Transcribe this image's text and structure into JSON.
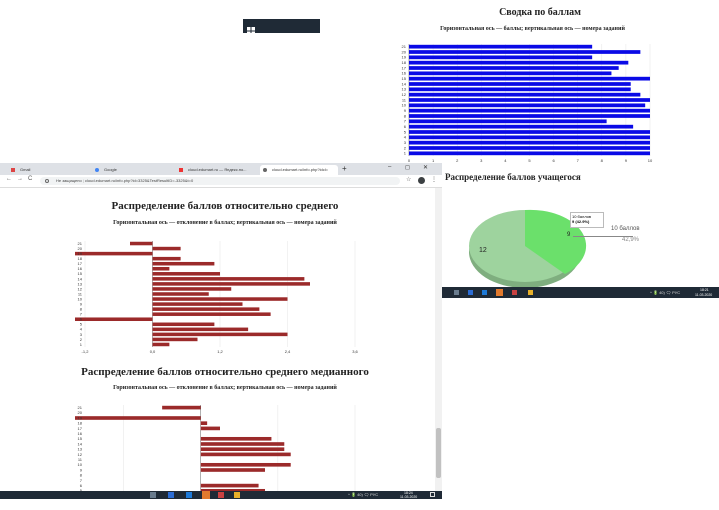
{
  "colors": {
    "blue_bars": "#0a0ae6",
    "red_bars": "#9b2a2a",
    "taskbar": "#1f2a36",
    "pie_light": "#6be06b",
    "pie_dark": "#9ed39e"
  },
  "top_left_tile": {
    "icon": "windows-logo-icon"
  },
  "summary": {
    "title": "Сводка по баллам",
    "subtitle": "Горизонтальная ось — баллы; вертикальная ось — номера заданий"
  },
  "student_dist": {
    "title": "Распределение баллов учащегося",
    "tooltip_line1": "10 баллов",
    "tooltip_line2": "9 (42.9%)",
    "label_9": "9",
    "label_12": "12",
    "legend_label": "10 баллов",
    "legend_pct": "42,9%"
  },
  "browser": {
    "tabs": [
      {
        "label": "Gmail",
        "icon": "mail-icon"
      },
      {
        "label": "Google",
        "icon": "google-icon"
      },
      {
        "label": "cloud.edumart.ru — Яндекс.по...",
        "icon": "yandex-icon"
      },
      {
        "label": "cloud.edumart.ru/info.php?idcl=",
        "icon": "globe-icon"
      }
    ],
    "new_tab": "+",
    "address_prefix": "Не защищено",
    "address": "cloud.edumart.ru/info.php?id=3325&TestResultID=-3325&t=0",
    "win_min": "–",
    "win_max": "◻",
    "win_close": "✕"
  },
  "section1": {
    "title": "Распределение баллов относительно среднего",
    "subtitle": "Горизонтальная ось — отклонение в баллах; вертикальная ось — номера заданий"
  },
  "section2": {
    "title": "Распределение баллов относительно среднего медианного",
    "subtitle": "Горизонтальная ось — отклонение в баллах; вертикальная ось — номера заданий"
  },
  "taskbar_right": {
    "tray": "^ 🔋 40) 🗨 РУС",
    "time": "18:21",
    "date": "11.03.2020"
  },
  "taskbar_bottom": {
    "tray": "^ 🔋 40) 🗨 РУС",
    "time": "18:24",
    "date": "11.03.2020"
  },
  "chart_data": [
    {
      "type": "bar",
      "orientation": "horizontal",
      "title": "Сводка по баллам",
      "subtitle": "Горизонтальная ось — баллы; вертикальная ось — номера заданий",
      "categories": [
        "1",
        "2",
        "3",
        "4",
        "5",
        "6",
        "7",
        "8",
        "9",
        "10",
        "11",
        "12",
        "13",
        "14",
        "15",
        "16",
        "17",
        "18",
        "19",
        "20",
        "21"
      ],
      "values": [
        10,
        10,
        10,
        10,
        10,
        9.3,
        8.2,
        10,
        10,
        9.8,
        10,
        9.6,
        9.2,
        9.2,
        10,
        8.4,
        8.7,
        9.1,
        7.6,
        9.6,
        7.6
      ],
      "xlim": [
        0,
        10
      ],
      "xticks": [
        "0",
        "1",
        "2",
        "3",
        "4",
        "5",
        "6",
        "7",
        "8",
        "9",
        "10"
      ]
    },
    {
      "type": "pie",
      "title": "Распределение баллов учащегося",
      "slices": [
        {
          "label": "10 баллов",
          "value": 9,
          "percent": "42,9%"
        },
        {
          "label": "",
          "value": 12
        }
      ]
    },
    {
      "type": "bar",
      "orientation": "horizontal",
      "title": "Распределение баллов относительно среднего",
      "subtitle": "Горизонтальная ось — отклонение в баллах; вертикальная ось — номера заданий",
      "categories": [
        "1",
        "2",
        "3",
        "4",
        "5",
        "6",
        "7",
        "8",
        "9",
        "10",
        "11",
        "12",
        "13",
        "14",
        "15",
        "16",
        "17",
        "18",
        "19",
        "20",
        "21"
      ],
      "values": [
        0.3,
        0.8,
        2.4,
        1.7,
        1.1,
        -1.8,
        2.1,
        1.9,
        1.6,
        2.4,
        1.0,
        1.4,
        2.8,
        2.7,
        1.2,
        0.3,
        1.1,
        0.5,
        -2.5,
        0.5,
        -0.4
      ],
      "xlim": [
        -1.2,
        3.6
      ],
      "xticks": [
        "-1,2",
        "0,0",
        "1,2",
        "2,4",
        "3,6"
      ]
    },
    {
      "type": "bar",
      "orientation": "horizontal",
      "title": "Распределение баллов относительно среднего медианного",
      "subtitle": "Горизонтальная ось — отклонение в баллах; вертикальная ось — номера заданий",
      "categories": [
        "1",
        "2",
        "3",
        "4",
        "5",
        "6",
        "7",
        "8",
        "9",
        "10",
        "11",
        "12",
        "13",
        "14",
        "15",
        "16",
        "17",
        "18",
        "19",
        "20",
        "21"
      ],
      "values": [
        0,
        -1.2,
        0.4,
        1.0,
        1.0,
        0.9,
        0,
        0,
        1.0,
        1.4,
        0,
        1.4,
        1.3,
        1.3,
        1.1,
        0,
        0.3,
        0.1,
        -2.0,
        0,
        -0.6
      ],
      "xlim": [
        -1.8,
        2.4
      ]
    }
  ]
}
